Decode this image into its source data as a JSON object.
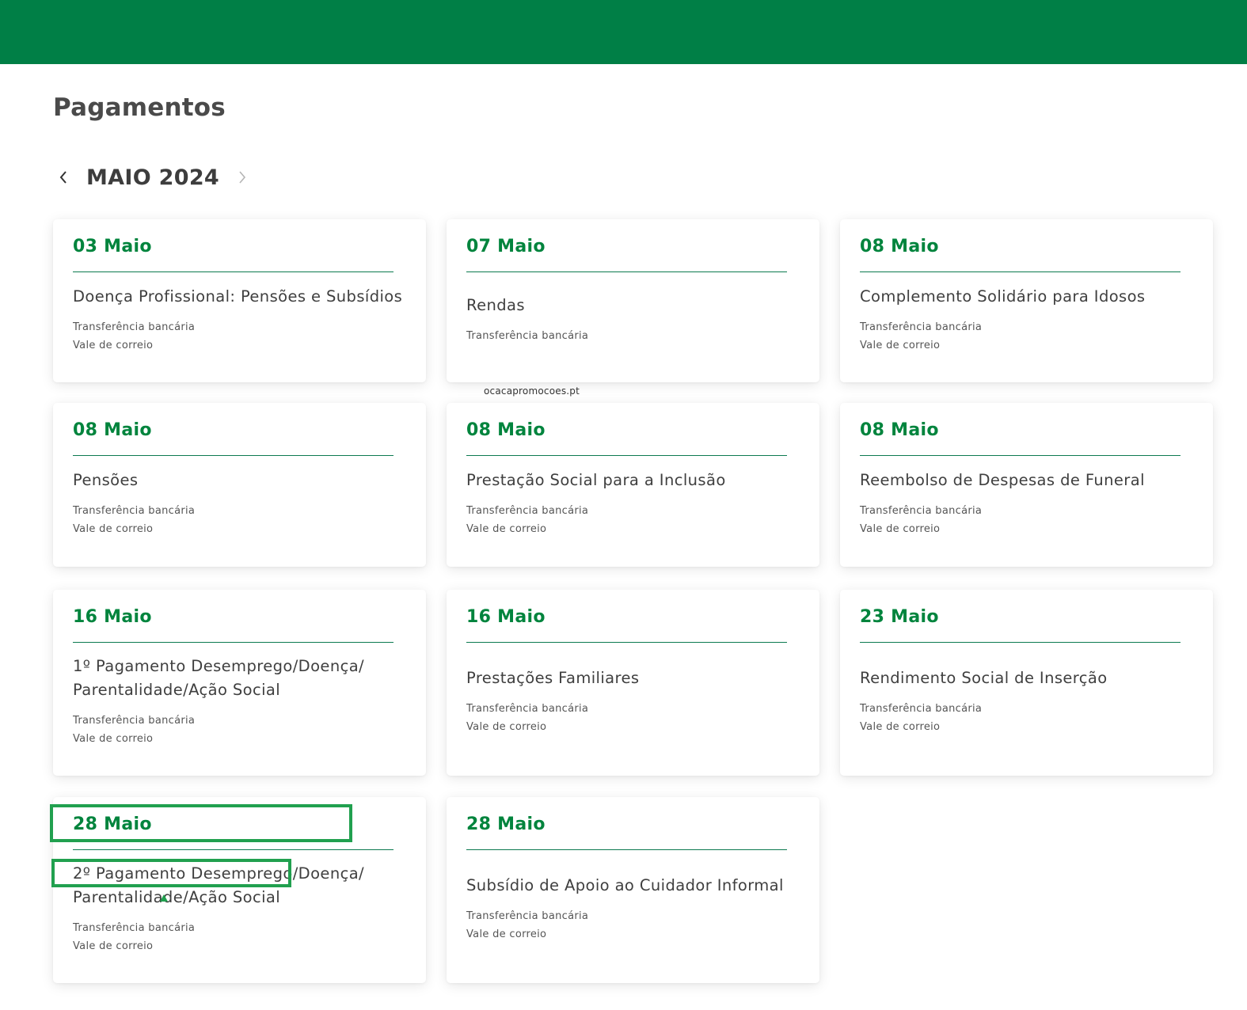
{
  "page": {
    "title": "Pagamentos",
    "month_label": "MAIO 2024",
    "prev_icon": "chevron-left-icon",
    "next_icon": "chevron-right-icon",
    "watermark": "ocacapromocoes.pt"
  },
  "colors": {
    "header_green": "#007f46",
    "date_green": "#00843d",
    "highlight_green": "#21a04f"
  },
  "cards": [
    {
      "date": "03 Maio",
      "title": "Doença Profissional: Pensões e Subsídios",
      "methods": [
        "Transferência bancária",
        "Vale de correio"
      ]
    },
    {
      "date": "07 Maio",
      "title": "Rendas",
      "methods": [
        "Transferência bancária"
      ]
    },
    {
      "date": "08 Maio",
      "title": "Complemento Solidário para Idosos",
      "methods": [
        "Transferência bancária",
        "Vale de correio"
      ]
    },
    {
      "date": "08 Maio",
      "title": "Pensões",
      "methods": [
        "Transferência bancária",
        "Vale de correio"
      ]
    },
    {
      "date": "08 Maio",
      "title": "Prestação Social para a Inclusão",
      "methods": [
        "Transferência bancária",
        "Vale de correio"
      ]
    },
    {
      "date": "08 Maio",
      "title": "Reembolso de Despesas de Funeral",
      "methods": [
        "Transferência bancária",
        "Vale de correio"
      ]
    },
    {
      "date": "16 Maio",
      "title": "1º Pagamento Desemprego/Doença/ Parentalidade/Ação Social",
      "methods": [
        "Transferência bancária",
        "Vale de correio"
      ]
    },
    {
      "date": "16 Maio",
      "title": "Prestações Familiares",
      "methods": [
        "Transferência bancária",
        "Vale de correio"
      ]
    },
    {
      "date": "23 Maio",
      "title": "Rendimento Social de Inserção",
      "methods": [
        "Transferência bancária",
        "Vale de correio"
      ]
    },
    {
      "date": "28 Maio",
      "title": "2º Pagamento Desemprego/Doença/ Parentalidade/Ação Social",
      "methods": [
        "Transferência bancária",
        "Vale de correio"
      ]
    },
    {
      "date": "28 Maio",
      "title": "Subsídio de Apoio ao Cuidador Informal",
      "methods": [
        "Transferência bancária",
        "Vale de correio"
      ]
    }
  ]
}
